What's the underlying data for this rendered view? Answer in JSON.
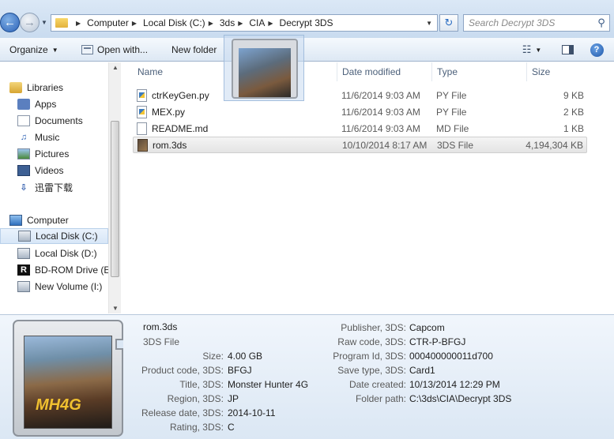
{
  "address_bar": {
    "breadcrumbs": [
      "Computer",
      "Local Disk (C:)",
      "3ds",
      "CIA",
      "Decrypt 3DS"
    ],
    "search_placeholder": "Search Decrypt 3DS"
  },
  "toolbar": {
    "organize": "Organize",
    "open_with": "Open with...",
    "new_folder": "New folder"
  },
  "nav": {
    "libraries": "Libraries",
    "apps": "Apps",
    "documents": "Documents",
    "music": "Music",
    "pictures": "Pictures",
    "videos": "Videos",
    "xunlei": "迅雷下载",
    "computer": "Computer",
    "local_c": "Local Disk (C:)",
    "local_d": "Local Disk (D:)",
    "bd_rom": "BD-ROM Drive (E",
    "new_volume": "New Volume (I:)"
  },
  "columns": {
    "name": "Name",
    "date": "Date modified",
    "type": "Type",
    "size": "Size"
  },
  "files": [
    {
      "name": "ctrKeyGen.py",
      "date": "11/6/2014 9:03 AM",
      "type": "PY File",
      "size": "9 KB"
    },
    {
      "name": "MEX.py",
      "date": "11/6/2014 9:03 AM",
      "type": "PY File",
      "size": "2 KB"
    },
    {
      "name": "README.md",
      "date": "11/6/2014 9:03 AM",
      "type": "MD File",
      "size": "1 KB"
    },
    {
      "name": "rom.3ds",
      "date": "10/10/2014 8:17 AM",
      "type": "3DS File",
      "size": "4,194,304 KB"
    }
  ],
  "details": {
    "title": "rom.3ds",
    "subtitle": "3DS File",
    "left_props": [
      {
        "label": "Size:",
        "value": "4.00 GB"
      },
      {
        "label": "Product code, 3DS:",
        "value": "BFGJ"
      },
      {
        "label": "Title, 3DS:",
        "value": "Monster Hunter 4G"
      },
      {
        "label": "Region, 3DS:",
        "value": "JP"
      },
      {
        "label": "Release date, 3DS:",
        "value": "2014-10-11"
      },
      {
        "label": "Rating, 3DS:",
        "value": "C"
      }
    ],
    "right_props": [
      {
        "label": "Publisher, 3DS:",
        "value": "Capcom"
      },
      {
        "label": "Raw code, 3DS:",
        "value": "CTR-P-BFGJ"
      },
      {
        "label": "Program Id, 3DS:",
        "value": "000400000011d700"
      },
      {
        "label": "Save type, 3DS:",
        "value": "Card1"
      },
      {
        "label": "Date created:",
        "value": "10/13/2014 12:29 PM"
      },
      {
        "label": "Folder path:",
        "value": "C:\\3ds\\CIA\\Decrypt 3DS"
      }
    ]
  },
  "colors": {
    "chrome_top": "#dbe8f6",
    "selection": "#d7e6f7",
    "details_bg": "#dbe7f4"
  }
}
